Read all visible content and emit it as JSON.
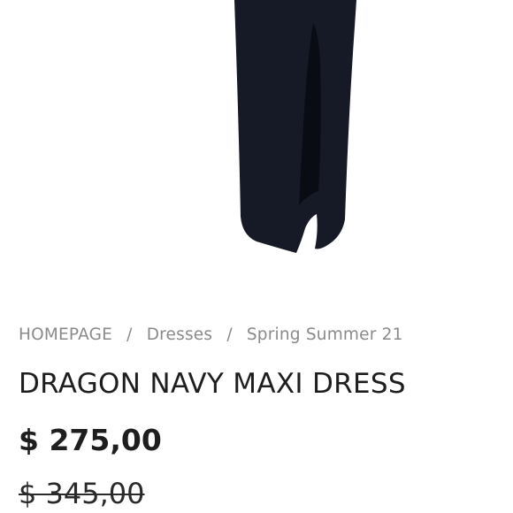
{
  "colors": {
    "dress": "#161a26",
    "slit_shadow": "#0a0c14",
    "text_dark": "#1e1e1e",
    "text_muted": "#8a8a8a"
  },
  "breadcrumb": {
    "items": [
      "HOMEPAGE",
      "Dresses",
      "Spring Summer 21"
    ],
    "separator": "/"
  },
  "product": {
    "title": "DRAGON NAVY MAXI DRESS",
    "price": "$ 275,00",
    "old_price": "$ 345,00"
  }
}
